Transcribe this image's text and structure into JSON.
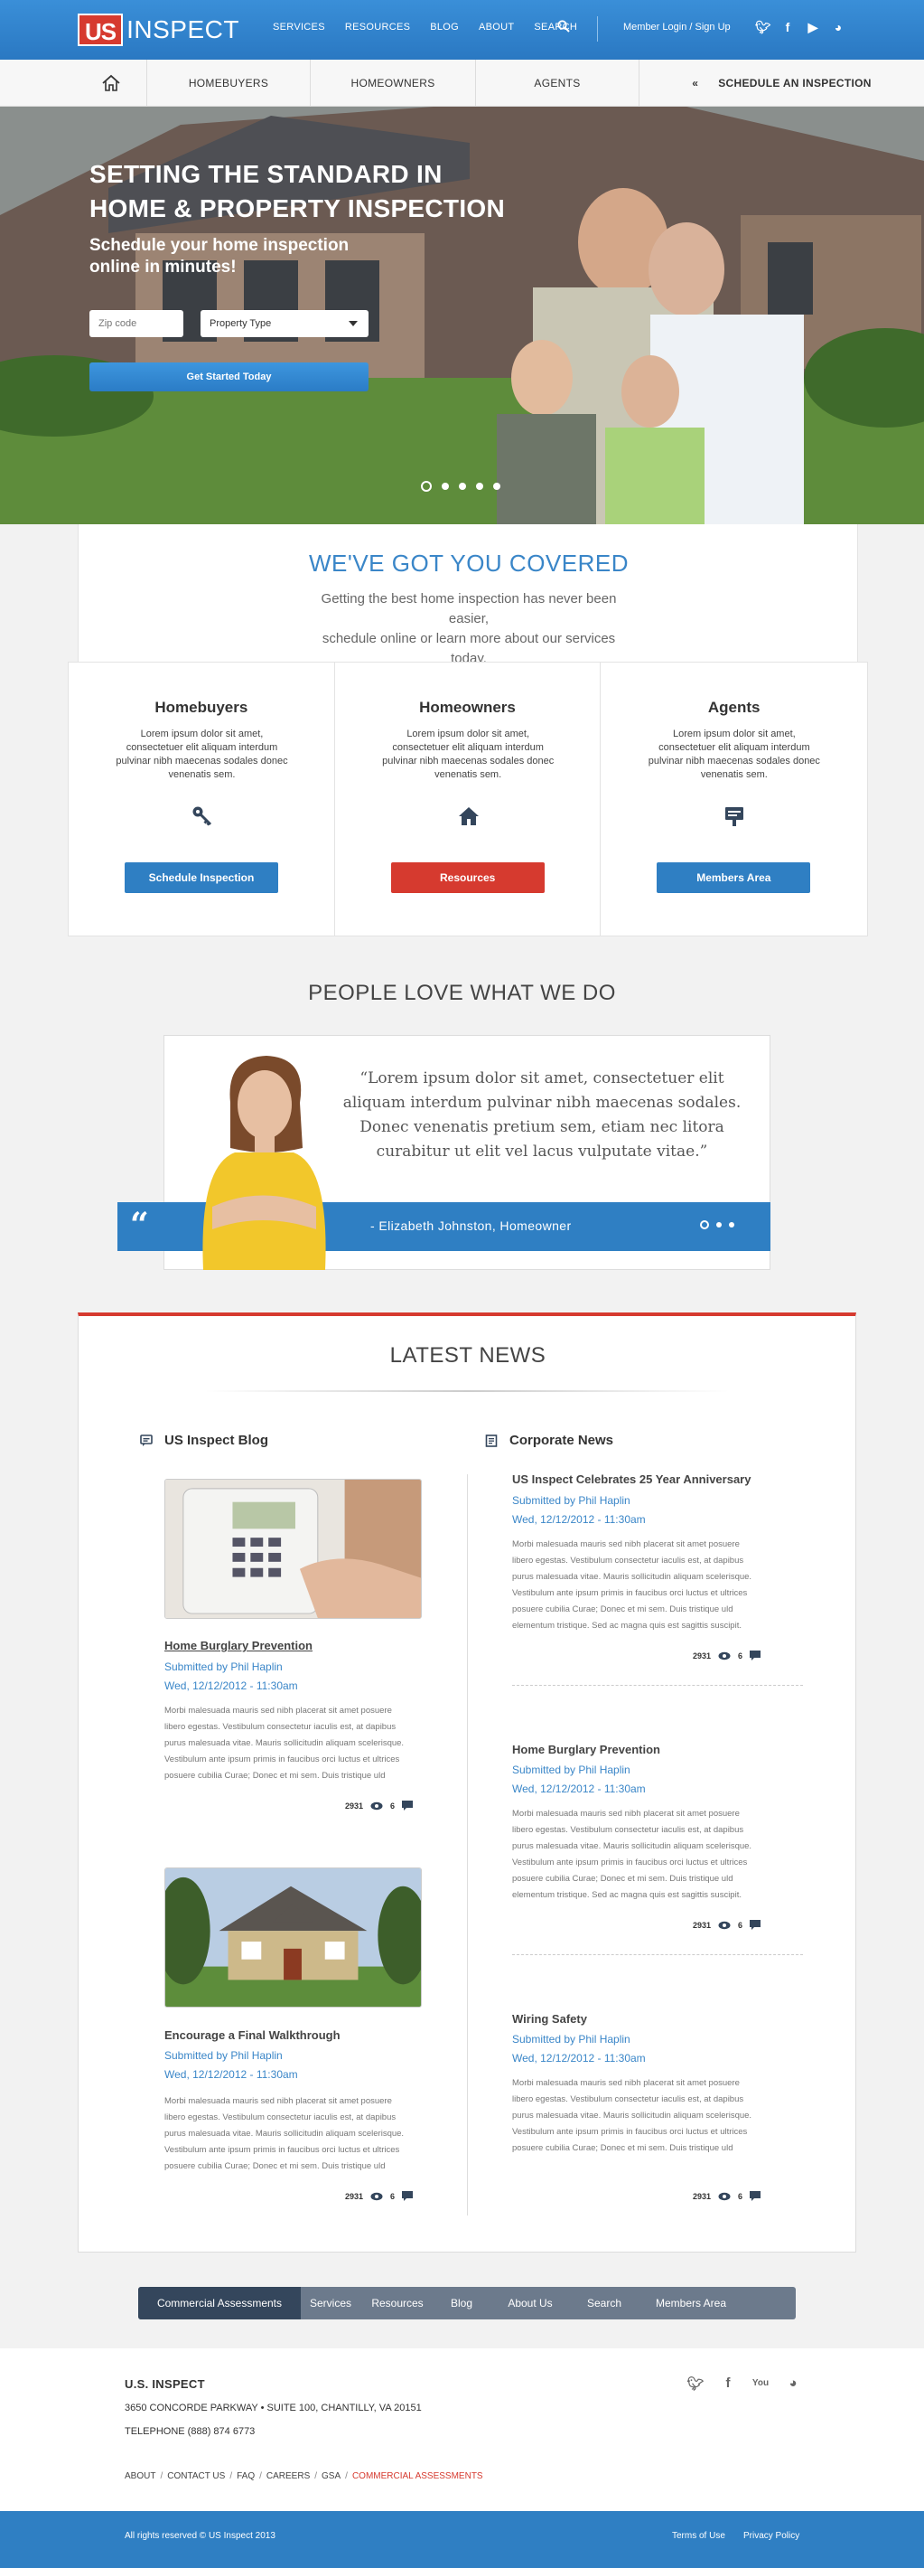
{
  "header": {
    "logo_us": "US",
    "logo_inspect": "INSPECT",
    "nav": [
      "SERVICES",
      "RESOURCES",
      "BLOG",
      "ABOUT",
      "SEARCH"
    ],
    "member_login": "Member Login",
    "sign_up": "Sign Up",
    "login_sep": "/",
    "social": [
      "twitter-icon",
      "facebook-icon",
      "youtube-icon",
      "blog-icon"
    ]
  },
  "subnav": {
    "items": [
      "HOMEBUYERS",
      "HOMEOWNERS",
      "AGENTS"
    ],
    "schedule": "SCHEDULE AN INSPECTION",
    "schedule_chevron": "«"
  },
  "hero": {
    "title_line1": "SETTING THE STANDARD IN",
    "title_line2": "HOME & PROPERTY INSPECTION",
    "subtitle_line1": "Schedule your home inspection",
    "subtitle_line2": "online in minutes!",
    "zip_placeholder": "Zip code",
    "property_type": "Property Type",
    "cta": "Get Started Today",
    "slides": 5,
    "active_slide": 1
  },
  "covered": {
    "title": "WE'VE GOT YOU COVERED",
    "sub_line1": "Getting the best home inspection has never been easier,",
    "sub_line2": "schedule online or learn more about our services today."
  },
  "cards": [
    {
      "title": "Homebuyers",
      "body": "Lorem ipsum dolor sit amet, consectetuer elit aliquam interdum pulvinar nibh maecenas sodales donec venenatis sem.",
      "icon": "key-icon",
      "button": "Schedule Inspection",
      "color": "#2f7fc3"
    },
    {
      "title": "Homeowners",
      "body": "Lorem ipsum dolor sit amet, consectetuer elit aliquam interdum pulvinar nibh maecenas sodales donec venenatis sem.",
      "icon": "house-icon",
      "button": "Resources",
      "color": "#d63a2f"
    },
    {
      "title": "Agents",
      "body": "Lorem ipsum dolor sit amet, consectetuer elit aliquam interdum pulvinar nibh maecenas sodales donec venenatis sem.",
      "icon": "sign-icon",
      "button": "Members Area",
      "color": "#2f7fc3"
    }
  ],
  "testimonial": {
    "section_title": "PEOPLE LOVE WHAT WE DO",
    "quote_line1": "“Lorem ipsum dolor sit amet, consectetuer elit",
    "quote_line2": "aliquam interdum pulvinar nibh maecenas sodales.",
    "quote_line3": "Donec venenatis pretium sem, etiam nec litora",
    "quote_line4": "curabitur ut elit vel lacus vulputate vitae.”",
    "author": "- Elizabeth Johnston,  Homeowner",
    "quote_mark": "“"
  },
  "news": {
    "title": "LATEST NEWS",
    "blog_heading": "US Inspect Blog",
    "corp_heading": "Corporate News",
    "blog_posts": [
      {
        "title": "Home Burglary Prevention",
        "author": "Submitted by Phil Haplin",
        "date": "Wed, 12/12/2012 - 11:30am",
        "body": [
          "Morbi malesuada mauris sed nibh placerat sit amet posuere",
          "libero egestas. Vestibulum consectetur iaculis est, at dapibus",
          "purus malesuada vitae. Mauris sollicitudin aliquam scelerisque.",
          "Vestibulum ante ipsum primis in faucibus orci luctus et ultrices",
          "posuere cubilia Curae; Donec et mi sem. Duis tristique uld"
        ],
        "views": "2931",
        "comments": "6"
      },
      {
        "title": "Encourage a Final Walkthrough",
        "author": "Submitted by Phil Haplin",
        "date": "Wed, 12/12/2012 - 11:30am",
        "body": [
          "Morbi malesuada mauris sed nibh placerat sit amet posuere",
          "libero egestas. Vestibulum consectetur iaculis est, at dapibus",
          "purus malesuada vitae. Mauris sollicitudin aliquam scelerisque.",
          "Vestibulum ante ipsum primis in faucibus orci luctus et ultrices",
          "posuere cubilia Curae; Donec et mi sem. Duis tristique uld"
        ],
        "views": "2931",
        "comments": "6"
      }
    ],
    "corp_posts": [
      {
        "title": "US Inspect Celebrates 25 Year Anniversary",
        "author": "Submitted by Phil Haplin",
        "date": "Wed, 12/12/2012 - 11:30am",
        "body": [
          "Morbi malesuada mauris sed nibh placerat sit amet posuere",
          "libero egestas. Vestibulum consectetur iaculis est, at dapibus",
          "purus malesuada vitae. Mauris sollicitudin aliquam scelerisque.",
          "Vestibulum ante ipsum primis in faucibus orci luctus et ultrices",
          "posuere cubilia Curae; Donec et mi sem. Duis tristique uld",
          "elementum tristique. Sed ac magna quis est sagittis suscipit."
        ],
        "views": "2931",
        "comments": "6"
      },
      {
        "title": "Home Burglary Prevention",
        "author": "Submitted by Phil Haplin",
        "date": "Wed, 12/12/2012 - 11:30am",
        "body": [
          "Morbi malesuada mauris sed nibh placerat sit amet posuere",
          "libero egestas. Vestibulum consectetur iaculis est, at dapibus",
          "purus malesuada vitae. Mauris sollicitudin aliquam scelerisque.",
          "Vestibulum ante ipsum primis in faucibus orci luctus et ultrices",
          "posuere cubilia Curae; Donec et mi sem. Duis tristique uld",
          "elementum tristique. Sed ac magna quis est sagittis suscipit."
        ],
        "views": "2931",
        "comments": "6"
      },
      {
        "title": "Wiring Safety",
        "author": "Submitted by Phil Haplin",
        "date": "Wed, 12/12/2012 - 11:30am",
        "body": [
          "Morbi malesuada mauris sed nibh placerat sit amet posuere",
          "libero egestas. Vestibulum consectetur iaculis est, at dapibus",
          "purus malesuada vitae. Mauris sollicitudin aliquam scelerisque.",
          "Vestibulum ante ipsum primis in faucibus orci luctus et ultrices",
          "posuere cubilia Curae; Donec et mi sem. Duis tristique uld"
        ],
        "views": "2931",
        "comments": "6"
      }
    ]
  },
  "bottom_nav": {
    "items": [
      "Commercial Assessments",
      "Services",
      "Resources",
      "Blog",
      "About Us",
      "Search",
      "Members Area"
    ],
    "active": "Commercial Assessments"
  },
  "footer": {
    "name": "U.S. INSPECT",
    "address": "3650 CONCORDE PARKWAY • SUITE 100, CHANTILLY, VA 20151",
    "telephone": "TELEPHONE  (888) 874 6773",
    "links": [
      "ABOUT",
      "CONTACT US",
      "FAQ",
      "CAREERS",
      "GSA",
      "COMMERCIAL ASSESSMENTS"
    ],
    "link_sep": "/",
    "social": [
      "twitter-icon",
      "facebook-icon",
      "youtube-icon",
      "blog-icon"
    ],
    "copyright": "All rights reserved  © US Inspect 2013",
    "terms": "Terms of Use",
    "privacy": "Privacy Policy"
  },
  "colors": {
    "brand_blue": "#2f7fc3",
    "brand_red": "#d63a2f",
    "nav_gray": "#6c7a8c",
    "active_nav": "#34465c"
  }
}
